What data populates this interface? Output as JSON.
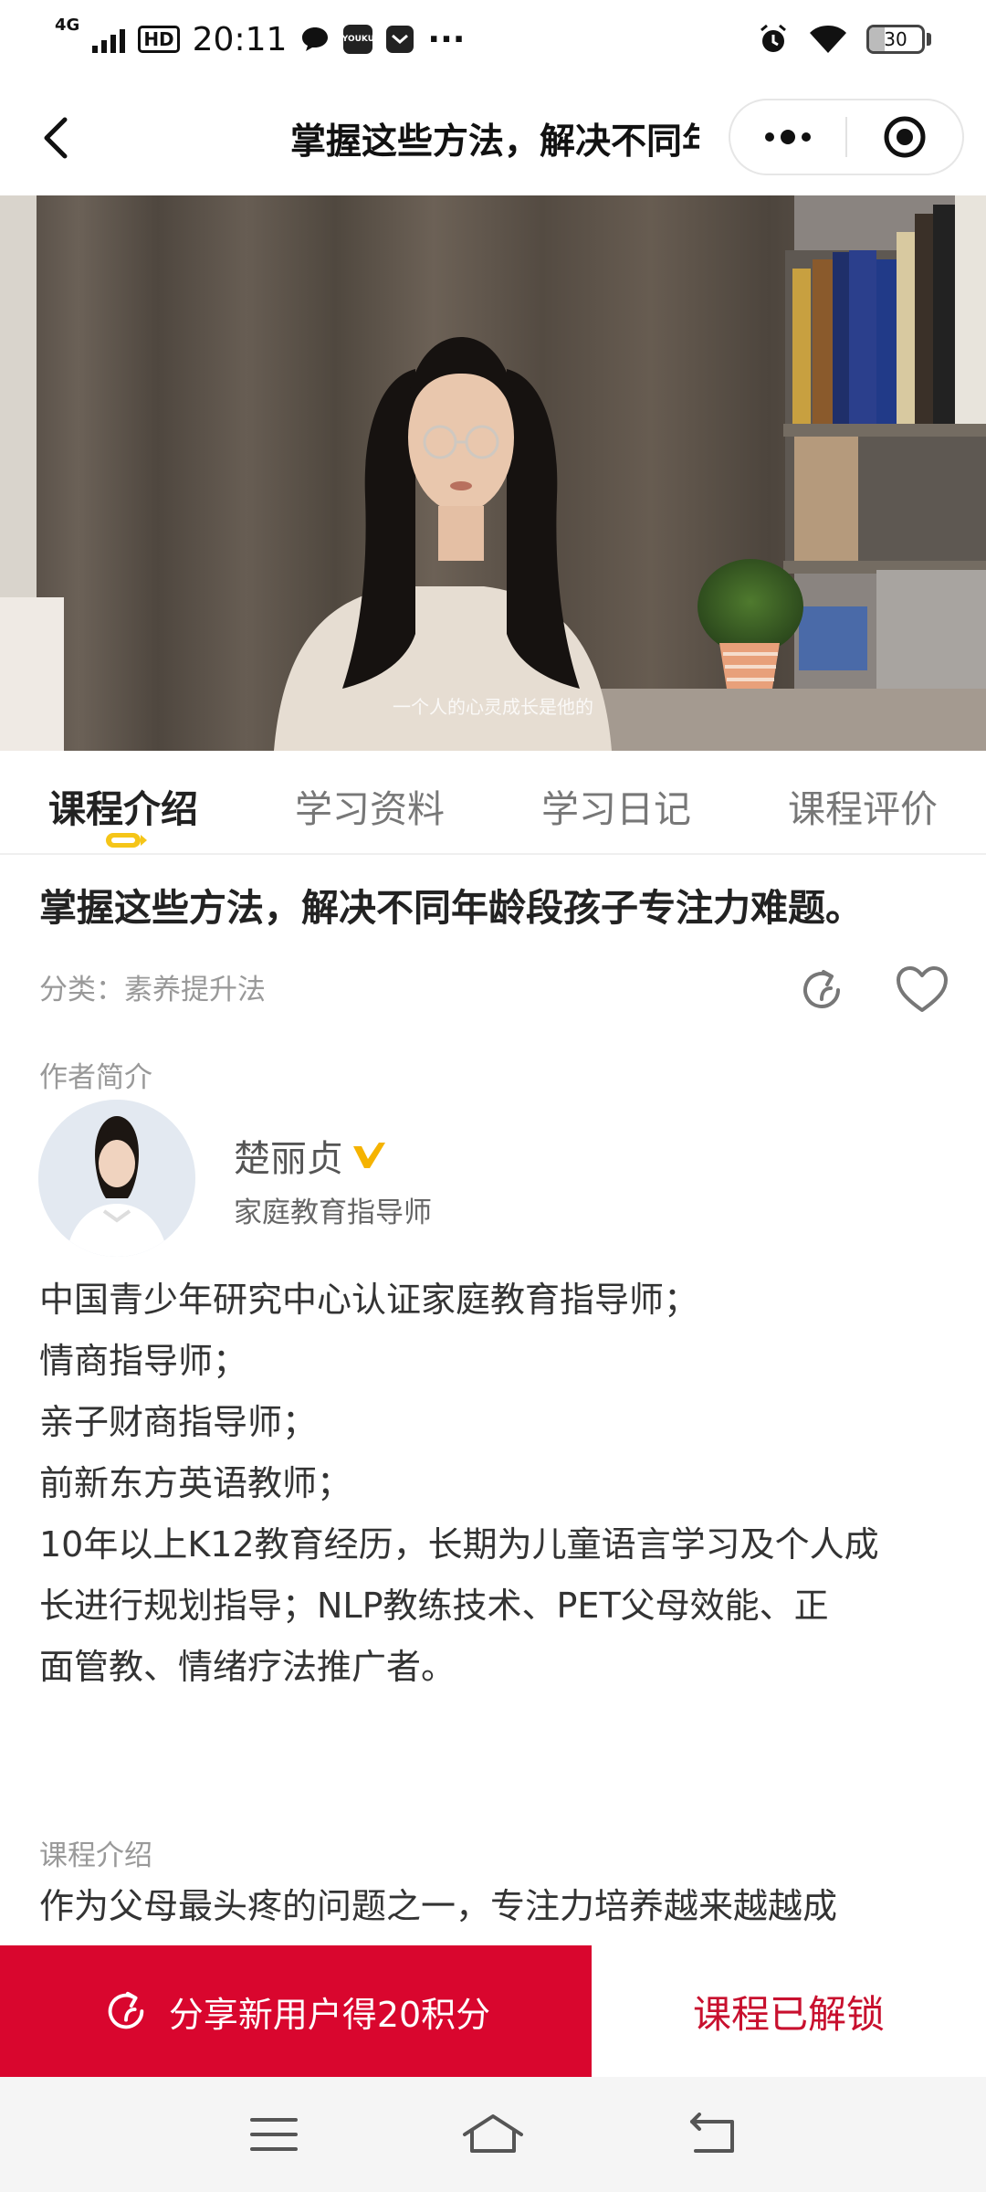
{
  "status_bar": {
    "network": "4G",
    "hd": "HD",
    "time": "20:11",
    "app_badge": "YOUKU",
    "more": "···",
    "battery_level": "30",
    "battery_fraction": 0.3
  },
  "nav": {
    "title": "掌握这些方法，解决不同年龄段孩子专注力难题。",
    "menu_icon": "more-dots-icon",
    "close_icon": "target-close-icon",
    "back_icon": "chevron-left-icon"
  },
  "video": {
    "subtitle": "一个人的心灵成长是他的"
  },
  "tabs": [
    {
      "label": "课程介绍",
      "active": true
    },
    {
      "label": "学习资料",
      "active": false
    },
    {
      "label": "学习日记",
      "active": false
    },
    {
      "label": "课程评价",
      "active": false
    }
  ],
  "course": {
    "title": "掌握这些方法，解决不同年龄段孩子专注力难题。",
    "category": "分类：素养提升法"
  },
  "author": {
    "heading": "作者简介",
    "name": "楚丽贞",
    "role": "家庭教育指导师",
    "verified_color": "#f5b300",
    "bio": [
      "中国青少年研究中心认证家庭教育指导师；",
      "情商指导师；",
      "亲子财商指导师；",
      "前新东方英语教师；",
      "10年以上K12教育经历，长期为儿童语言学习及个人成",
      "长进行规划指导；NLP教练技术、PET父母效能、正",
      "面管教、情绪疗法推广者。"
    ]
  },
  "intro": {
    "heading": "课程介绍",
    "text": "作为父母最头疼的问题之一，专注力培养越来越越成"
  },
  "actions": {
    "share_label": "分享新用户得20积分",
    "unlocked_label": "课程已解锁",
    "accent": "#d9062e"
  },
  "system_nav": {
    "menu_icon": "menu-icon",
    "home_icon": "home-icon",
    "back_icon": "back-icon"
  }
}
